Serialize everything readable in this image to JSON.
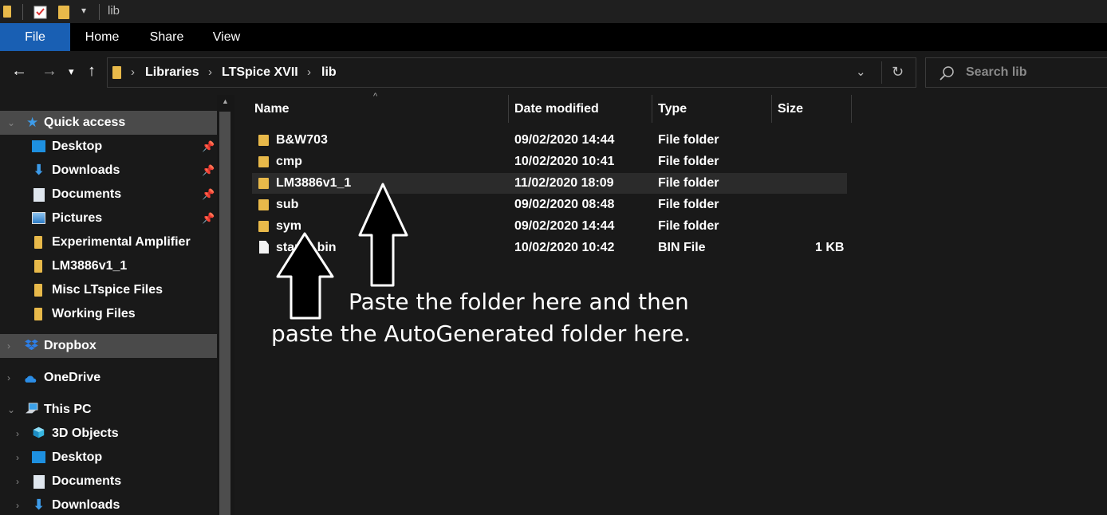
{
  "titlebar": {
    "title": "lib"
  },
  "ribbon": {
    "tabs": [
      "File",
      "Home",
      "Share",
      "View"
    ]
  },
  "address": {
    "crumbs": [
      "Libraries",
      "LTSpice XVII",
      "lib"
    ],
    "search_placeholder": "Search lib"
  },
  "sidebar": {
    "items": [
      {
        "label": "Quick access",
        "icon": "star-icon",
        "selected": true,
        "expanded": true,
        "indent": 0,
        "pinned": false
      },
      {
        "label": "Desktop",
        "icon": "desktop-icon",
        "indent": 1,
        "pinned": true
      },
      {
        "label": "Downloads",
        "icon": "download-icon",
        "indent": 1,
        "pinned": true
      },
      {
        "label": "Documents",
        "icon": "documents-icon",
        "indent": 1,
        "pinned": true
      },
      {
        "label": "Pictures",
        "icon": "pictures-icon",
        "indent": 1,
        "pinned": true
      },
      {
        "label": "Experimental Amplifier",
        "icon": "folder-icon",
        "indent": 1,
        "pinned": false
      },
      {
        "label": "LM3886v1_1",
        "icon": "folder-icon",
        "indent": 1,
        "pinned": false
      },
      {
        "label": "Misc LTspice Files",
        "icon": "folder-icon",
        "indent": 1,
        "pinned": false
      },
      {
        "label": "Working Files",
        "icon": "folder-icon",
        "indent": 1,
        "pinned": false
      },
      {
        "label": "Dropbox",
        "icon": "dropbox-icon",
        "indent": 0,
        "selected": true
      },
      {
        "label": "OneDrive",
        "icon": "onedrive-icon",
        "indent": 0
      },
      {
        "label": "This PC",
        "icon": "pc-icon",
        "indent": 0,
        "expanded": true
      },
      {
        "label": "3D Objects",
        "icon": "cube-icon",
        "indent": 1
      },
      {
        "label": "Desktop",
        "icon": "desktop-icon",
        "indent": 1
      },
      {
        "label": "Documents",
        "icon": "documents-icon",
        "indent": 1
      },
      {
        "label": "Downloads",
        "icon": "download-icon",
        "indent": 1
      }
    ]
  },
  "columns": {
    "name": "Name",
    "date": "Date modified",
    "type": "Type",
    "size": "Size"
  },
  "files": [
    {
      "name": "B&W703",
      "date": "09/02/2020 14:44",
      "type": "File folder",
      "size": "",
      "icon": "folder-icon"
    },
    {
      "name": "cmp",
      "date": "10/02/2020 10:41",
      "type": "File folder",
      "size": "",
      "icon": "folder-icon"
    },
    {
      "name": "LM3886v1_1",
      "date": "11/02/2020 18:09",
      "type": "File folder",
      "size": "",
      "icon": "folder-icon",
      "hover": true
    },
    {
      "name": "sub",
      "date": "09/02/2020 08:48",
      "type": "File folder",
      "size": "",
      "icon": "folder-icon"
    },
    {
      "name": "sym",
      "date": "09/02/2020 14:44",
      "type": "File folder",
      "size": "",
      "icon": "folder-icon"
    },
    {
      "name": "stamp.bin",
      "date": "10/02/2020 10:42",
      "type": "BIN File",
      "size": "1 KB",
      "icon": "file-icon"
    }
  ],
  "annotation": {
    "line1": "Paste the folder here and then",
    "line2": "paste the AutoGenerated folder here."
  },
  "colors": {
    "accent": "#195fb3",
    "folder": "#e8b94a",
    "background": "#191919"
  }
}
